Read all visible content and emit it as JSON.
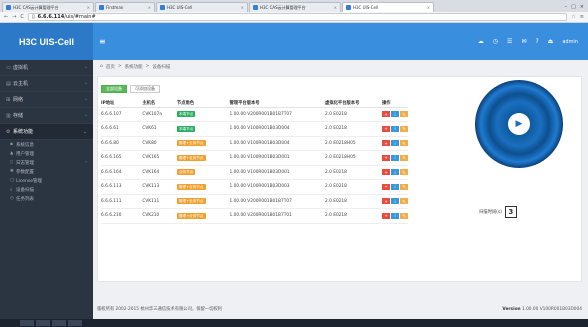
{
  "browser": {
    "tabs": [
      {
        "label": "H3C CAS云计算管理平台",
        "active": false
      },
      {
        "label": "Firstman",
        "active": false
      },
      {
        "label": "H3C UIS-Cell",
        "active": false
      },
      {
        "label": "H3C CAS云计算管理平台",
        "active": false
      },
      {
        "label": "H3C UIS-Cell",
        "active": true
      }
    ],
    "url_prefix": "6.6.6.114",
    "url_path": "/uis/#main#"
  },
  "app": {
    "title": "H3C UIS-Cell",
    "menu_icon": "menu-icon",
    "header_icons": [
      "cloud-icon",
      "clock-icon",
      "list-icon",
      "chat-icon",
      "help-icon",
      "logout-icon"
    ],
    "user": "admin"
  },
  "sidebar": {
    "items": [
      {
        "label": "虚拟机",
        "icon": "monitor-icon",
        "active": false
      },
      {
        "label": "云主机",
        "icon": "server-icon",
        "active": false
      },
      {
        "label": "网络",
        "icon": "network-icon",
        "active": false
      },
      {
        "label": "存储",
        "icon": "storage-icon",
        "active": false
      },
      {
        "label": "系统功能",
        "icon": "gear-icon",
        "active": true
      }
    ],
    "subitems": [
      {
        "label": "系统信息",
        "icon": "info-icon"
      },
      {
        "label": "用户管理",
        "icon": "user-icon"
      },
      {
        "label": "日志管理",
        "icon": "log-icon"
      },
      {
        "label": "参数配置",
        "icon": "config-icon"
      },
      {
        "label": "License管理",
        "icon": "license-icon"
      },
      {
        "label": "设备扫描",
        "icon": "search-icon"
      },
      {
        "label": "任务列表",
        "icon": "task-icon"
      }
    ]
  },
  "breadcrumb": {
    "items": [
      "首页",
      "系统功能",
      "设备扫描"
    ]
  },
  "panel": {
    "tabs": [
      "全部设备",
      "可添加设备"
    ],
    "columns": [
      "IP地址",
      "主机名",
      "节点角色",
      "管理平台版本号",
      "虚拟化平台版本号",
      "操作"
    ],
    "rows": [
      {
        "ip": "6.6.6.107",
        "host": "CVK107a",
        "role": "本端节点",
        "role_color": "green",
        "mgmt": "1.00.00 V200R001B01B7T07",
        "virt": "2.0 E0218"
      },
      {
        "ip": "6.6.6.61",
        "host": "CVK61",
        "role": "本端节点",
        "role_color": "green",
        "mgmt": "1.00.00 V100R001B03D004",
        "virt": "2.0 E0218"
      },
      {
        "ip": "6.6.6.80",
        "host": "CVK80",
        "role": "管理+业务节点",
        "role_color": "orange",
        "mgmt": "1.00.00 V100R001B03D004",
        "virt": "2.0 E0218H05"
      },
      {
        "ip": "6.6.6.165",
        "host": "CVK165",
        "role": "管理+业务节点",
        "role_color": "orange",
        "mgmt": "1.00.00 V100R001B03D001",
        "virt": "2.0 E0218H05"
      },
      {
        "ip": "6.6.6.164",
        "host": "CVK164",
        "role": "业务节点",
        "role_color": "orange",
        "mgmt": "1.00.00 V100R001B03D001",
        "virt": "2.0 E0218"
      },
      {
        "ip": "6.6.6.113",
        "host": "CVK113",
        "role": "管理+业务节点",
        "role_color": "orange",
        "mgmt": "1.00.00 V100R001B03D003",
        "virt": "2.0 E0218"
      },
      {
        "ip": "6.6.6.111",
        "host": "CVK111",
        "role": "管理+业务节点",
        "role_color": "orange",
        "mgmt": "1.00.00 V200R001B01B7T07",
        "virt": "2.0 E0218"
      },
      {
        "ip": "6.6.6.210",
        "host": "CVK210",
        "role": "管理+业务节点",
        "role_color": "orange",
        "mgmt": "1.00.00 V200R001B01B7T01",
        "virt": "2.0 E0218"
      }
    ],
    "op_icons": [
      "plus-icon",
      "info-icon",
      "edit-icon"
    ],
    "op_glyphs": [
      "+",
      "i",
      "✎"
    ]
  },
  "scan": {
    "timer_label": "扫描时间(s)",
    "timer_value": "3"
  },
  "footer": {
    "copyright": "版权所有 2002-2015 杭州华三通信技术有限公司，保留一切权利",
    "version_label": "Version",
    "version_value": "1.00.00 V100R001B03D004"
  },
  "colors": {
    "header": "#3a8ede",
    "sidebar": "#2b3441",
    "green_badge": "#27ae60",
    "orange_badge": "#f0a030"
  }
}
